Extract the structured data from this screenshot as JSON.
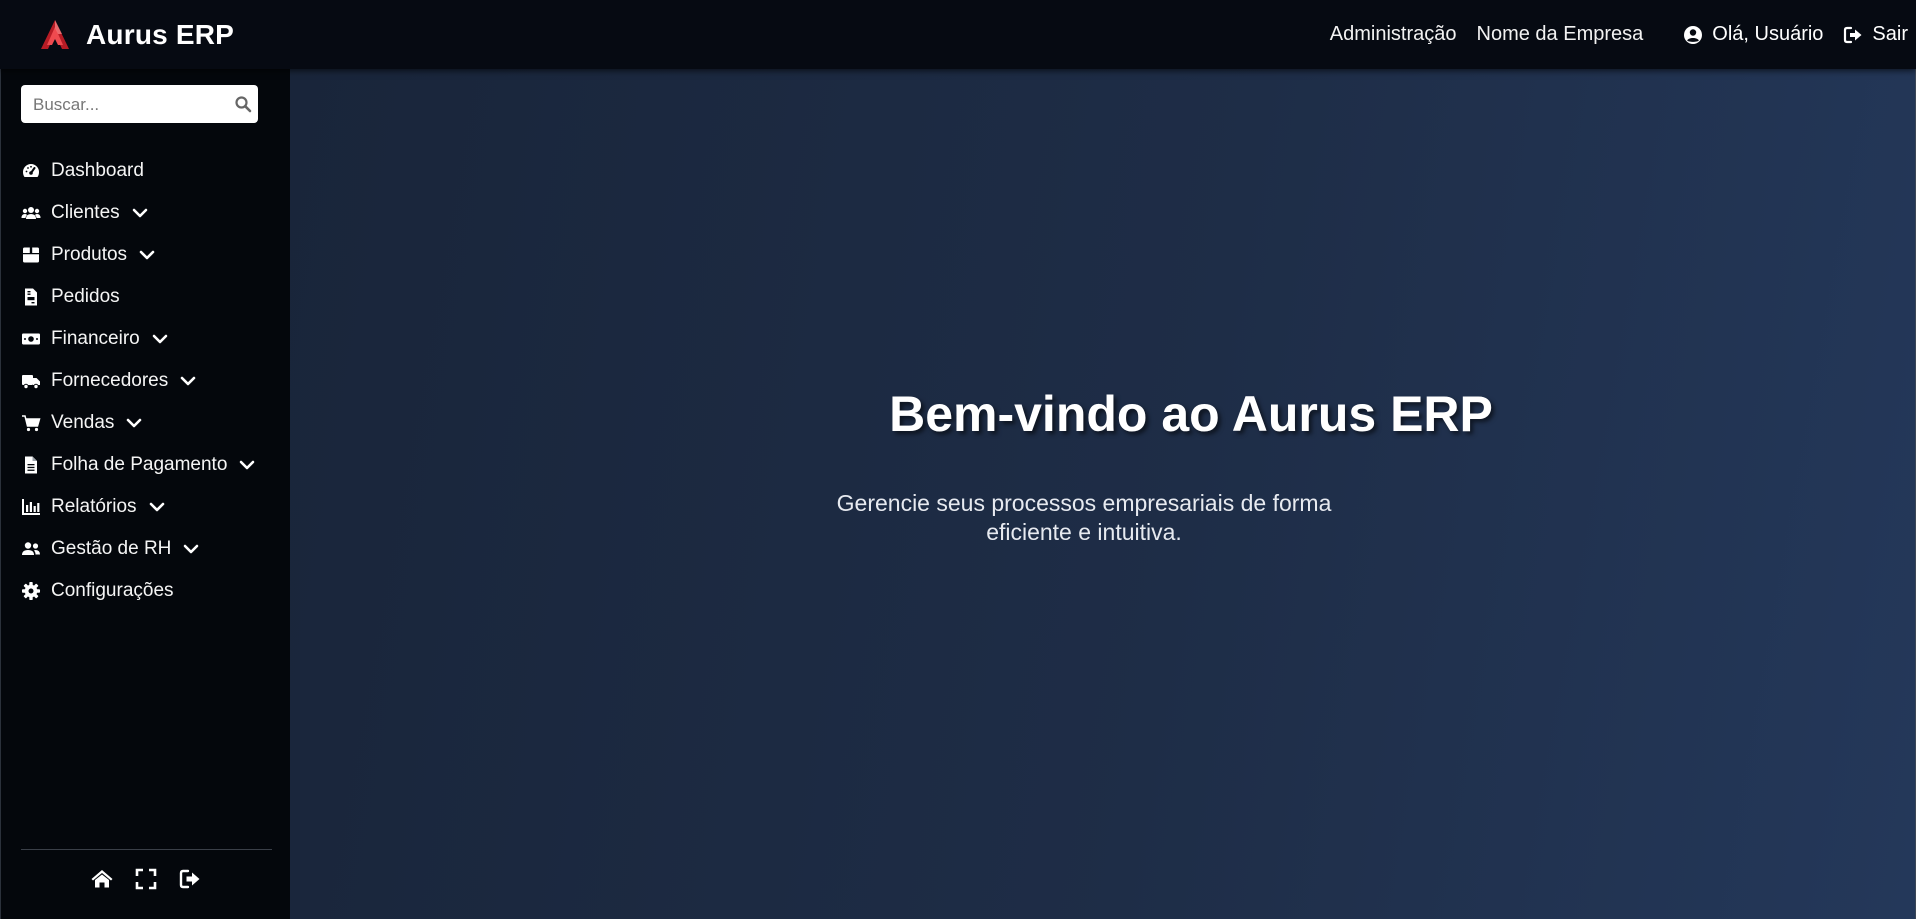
{
  "app": {
    "title": "Aurus ERP"
  },
  "topnav": {
    "admin_label": "Administração",
    "company_label": "Nome da Empresa",
    "user_label": "Olá, Usuário",
    "logout_label": "Sair"
  },
  "sidebar": {
    "search_placeholder": "Buscar...",
    "items": [
      {
        "label": "Dashboard",
        "icon": "gauge-icon",
        "submenu": false
      },
      {
        "label": "Clientes",
        "icon": "users-icon",
        "submenu": true
      },
      {
        "label": "Produtos",
        "icon": "box-icon",
        "submenu": true
      },
      {
        "label": "Pedidos",
        "icon": "invoice-icon",
        "submenu": false
      },
      {
        "label": "Financeiro",
        "icon": "money-icon",
        "submenu": true
      },
      {
        "label": "Fornecedores",
        "icon": "truck-icon",
        "submenu": true
      },
      {
        "label": "Vendas",
        "icon": "cart-icon",
        "submenu": true
      },
      {
        "label": "Folha de Pagamento",
        "icon": "file-icon",
        "submenu": true
      },
      {
        "label": "Relatórios",
        "icon": "chart-icon",
        "submenu": true
      },
      {
        "label": "Gestão de RH",
        "icon": "user-group-icon",
        "submenu": true
      },
      {
        "label": "Configurações",
        "icon": "gear-icon",
        "submenu": false
      }
    ],
    "bottom_icons": [
      "home-icon",
      "fullscreen-icon",
      "logout-icon"
    ]
  },
  "main": {
    "welcome_title": "Bem-vindo ao Aurus ERP",
    "welcome_subtitle": "Gerencie seus processos empresariais de forma eficiente e intuitiva."
  },
  "colors": {
    "brand_accent": "#d8313a",
    "topbar_bg": "#060a12",
    "sidebar_bg": "#04070c",
    "main_bg": "#1e2d47"
  }
}
